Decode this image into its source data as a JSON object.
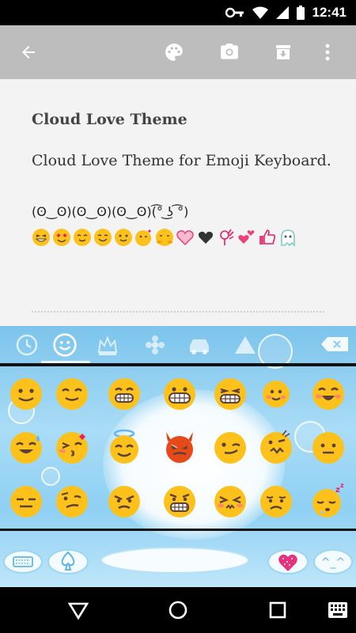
{
  "status_bar": {
    "time": "12:41",
    "icons": [
      "wifi-key-icon",
      "wifi-icon",
      "cell-signal-icon",
      "battery-icon"
    ]
  },
  "app_bar": {
    "background": "#bdbdbd",
    "actions": [
      "back-arrow-icon",
      "palette-icon",
      "camera-icon",
      "archive-icon",
      "more-vert-icon"
    ]
  },
  "content": {
    "title": "Cloud Love Theme",
    "description": "Cloud Love Theme for Emoji Keyboard.",
    "kaomoji": "(ʘ‿ʘ)(ʘ‿ʘ)(ʘ‿ʘ)"
  },
  "keyboard": {
    "tabs": [
      "recent-clock-icon",
      "smiley-icon",
      "crown-icon",
      "flower-icon",
      "car-icon",
      "triangle-icon"
    ],
    "active_tab": "smiley-icon",
    "bottom_keys": {
      "keyboard_switch": "keyboard-icon",
      "spade": "spade-icon",
      "heart": "heart-icon",
      "kaomoji_key": "^_^"
    }
  },
  "nav_bar": {
    "buttons": [
      "back-triangle-icon",
      "home-circle-icon",
      "recents-square-icon",
      "keyboard-picker-icon"
    ]
  }
}
